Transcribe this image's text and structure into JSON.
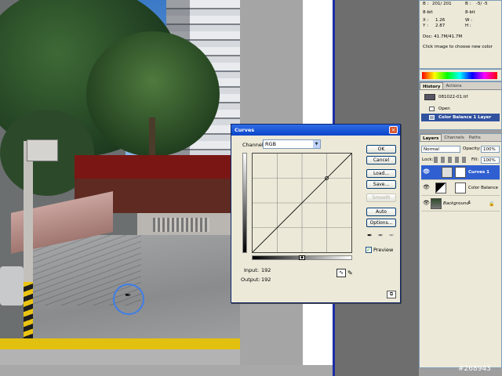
{
  "curves_dialog": {
    "title": "Curves",
    "close_glyph": "×",
    "channel_label": "Channel:",
    "channel_value": "RGB",
    "buttons": {
      "ok": "OK",
      "cancel": "Cancel",
      "load": "Load...",
      "save": "Save...",
      "smooth": "Smooth",
      "auto": "Auto",
      "options": "Options..."
    },
    "input_label": "Input:",
    "input_value": "192",
    "output_label": "Output:",
    "output_value": "192",
    "preview_label": "Preview",
    "preview_checked": true
  },
  "info_panel": {
    "b_label": "B :",
    "b_value": "201/ 201",
    "b2_label": "B :",
    "b2_value": "-5/ -5",
    "bit_left": "8-bit",
    "bit_right": "8-bit",
    "x_label": "X :",
    "x_value": "1.26",
    "y_label": "Y :",
    "y_value": "2.87",
    "w_label": "W :",
    "h_label": "H :",
    "doc": "Doc: 41.7M/41.7M",
    "hint": "Click image to choose new color"
  },
  "history_panel": {
    "tabs": [
      "History",
      "Actions"
    ],
    "snapshot": "081022-01.tif",
    "items": [
      "Open",
      "Color Balance 1 Layer"
    ],
    "selected_index": 1
  },
  "layers_panel": {
    "tabs": [
      "Layers",
      "Channels",
      "Paths"
    ],
    "blend_mode": "Normal",
    "opacity_label": "Opacity:",
    "opacity_value": "100%",
    "lock_label": "Lock:",
    "fill_label": "Fill:",
    "fill_value": "100%",
    "layers": [
      "Curves 1",
      "Color Balance 1",
      "Background"
    ],
    "selected_index": 0
  },
  "icons": {
    "eye": "visibility-eye-icon",
    "eyedropper": "eyedropper-icon",
    "sampler_cursor": "sampler-eyedropper-icon"
  },
  "colors": {
    "title_bar": "#0b45c8",
    "selected_layer": "#2f5fd1",
    "sampler_ring": "#3e7ee8"
  },
  "watermark": "#268943"
}
